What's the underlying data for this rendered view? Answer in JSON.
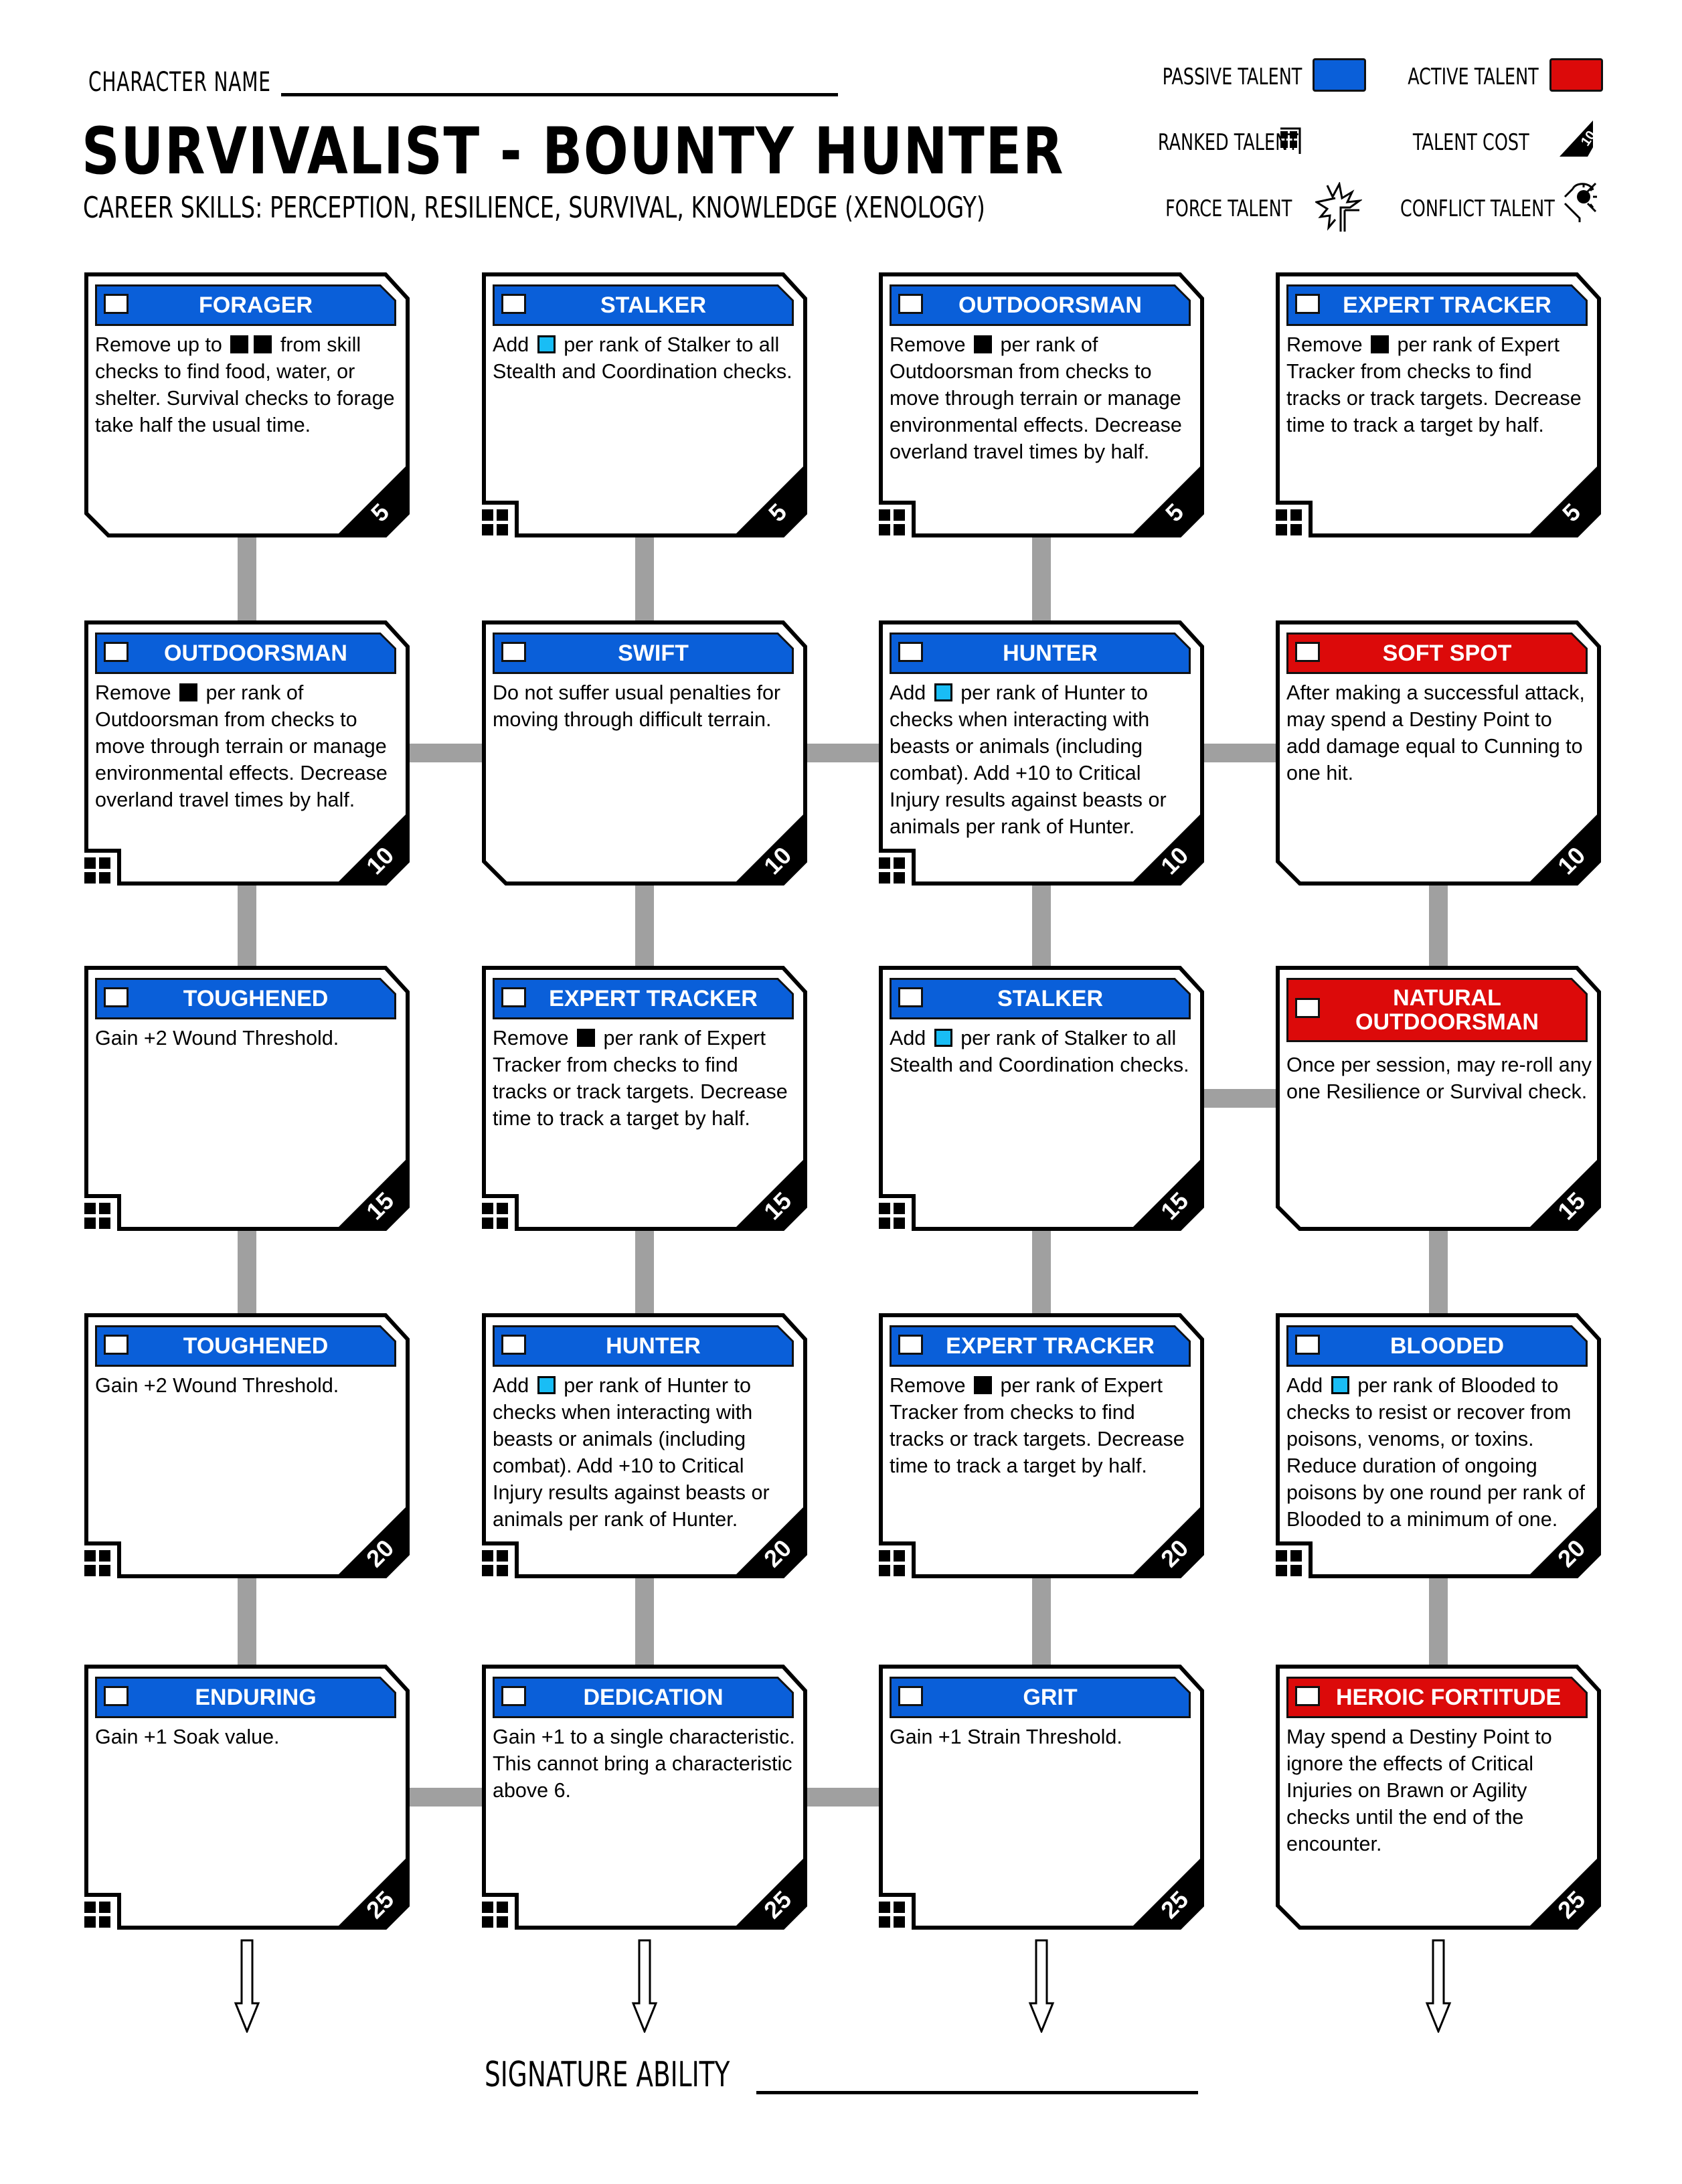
{
  "header": {
    "character_name_label": "CHARACTER NAME",
    "character_name_value": "",
    "title": "SURVIVALIST  -  BOUNTY HUNTER",
    "career_skills": "CAREER SKILLS:  PERCEPTION, RESILIENCE, SURVIVAL, KNOWLEDGE (XENOLOGY)"
  },
  "legend": {
    "passive_label": "PASSIVE TALENT",
    "active_label": "ACTIVE TALENT",
    "ranked_label": "RANKED TALENT",
    "cost_label": "TALENT COST",
    "cost_example": "10",
    "force_label": "FORCE TALENT",
    "conflict_label": "CONFLICT TALENT",
    "passive_color": "#0a5fd9",
    "active_color": "#dc0a0a"
  },
  "colors": {
    "passive": "#0a5fd9",
    "active": "#dc0a0a",
    "connector": "#a0a0a0",
    "boost_die": "#19bdf5",
    "setback_die": "#000000"
  },
  "talents": [
    [
      {
        "name": "FORAGER",
        "type": "passive",
        "ranked": false,
        "cost": "5",
        "desc": [
          "Remove up to ",
          "[setback]",
          "[setback]",
          " from skill checks to find food, water, or shelter. Survival checks to forage take half the usual time."
        ]
      },
      {
        "name": "STALKER",
        "type": "passive",
        "ranked": true,
        "cost": "5",
        "desc": [
          "Add ",
          "[boost]",
          " per rank of Stalker to all Stealth and Coordination checks."
        ]
      },
      {
        "name": "OUTDOORSMAN",
        "type": "passive",
        "ranked": true,
        "cost": "5",
        "desc": [
          "Remove ",
          "[setback]",
          " per rank of Outdoorsman from checks to move through terrain or manage environmental effects. Decrease overland travel times by half."
        ]
      },
      {
        "name": "EXPERT TRACKER",
        "type": "passive",
        "ranked": true,
        "cost": "5",
        "desc": [
          "Remove ",
          "[setback]",
          " per rank of Expert Tracker from checks to find tracks or track targets. Decrease time to track a target by half."
        ]
      }
    ],
    [
      {
        "name": "OUTDOORSMAN",
        "type": "passive",
        "ranked": true,
        "cost": "10",
        "desc": [
          "Remove ",
          "[setback]",
          " per rank of Outdoorsman from checks to move through terrain or manage environmental effects. Decrease overland travel times by half."
        ]
      },
      {
        "name": "SWIFT",
        "type": "passive",
        "ranked": false,
        "cost": "10",
        "desc": [
          "Do not suffer usual penalties for moving through difficult terrain."
        ]
      },
      {
        "name": "HUNTER",
        "type": "passive",
        "ranked": true,
        "cost": "10",
        "desc": [
          "Add ",
          "[boost]",
          " per rank of Hunter to checks when interacting with beasts or animals (including combat). Add +10 to Critical Injury results against beasts or animals per rank of Hunter."
        ]
      },
      {
        "name": "SOFT SPOT",
        "type": "active",
        "ranked": false,
        "cost": "10",
        "desc": [
          "After making a successful attack, may spend a Destiny Point to add damage equal to Cunning to one hit."
        ]
      }
    ],
    [
      {
        "name": "TOUGHENED",
        "type": "passive",
        "ranked": true,
        "cost": "15",
        "desc": [
          "Gain +2 Wound Threshold."
        ]
      },
      {
        "name": "EXPERT TRACKER",
        "type": "passive",
        "ranked": true,
        "cost": "15",
        "desc": [
          "Remove ",
          "[setback]",
          " per rank of Expert Tracker from checks to find tracks or track targets. Decrease time to track a target by half."
        ]
      },
      {
        "name": "STALKER",
        "type": "passive",
        "ranked": true,
        "cost": "15",
        "desc": [
          "Add ",
          "[boost]",
          " per rank of Stalker to all Stealth and Coordination checks."
        ]
      },
      {
        "name": "NATURAL OUTDOORSMAN",
        "type": "active",
        "ranked": false,
        "cost": "15",
        "desc": [
          "Once per session, may re-roll any one Resilience or Survival check."
        ]
      }
    ],
    [
      {
        "name": "TOUGHENED",
        "type": "passive",
        "ranked": true,
        "cost": "20",
        "desc": [
          "Gain +2 Wound Threshold."
        ]
      },
      {
        "name": "HUNTER",
        "type": "passive",
        "ranked": true,
        "cost": "20",
        "desc": [
          "Add ",
          "[boost]",
          " per rank of Hunter to checks when interacting with beasts or animals (including combat). Add +10 to Critical Injury results against beasts or animals per rank of Hunter."
        ]
      },
      {
        "name": "EXPERT TRACKER",
        "type": "passive",
        "ranked": true,
        "cost": "20",
        "desc": [
          "Remove ",
          "[setback]",
          " per rank of Expert Tracker from checks to find tracks or track targets. Decrease time to track a target by half."
        ]
      },
      {
        "name": "BLOODED",
        "type": "passive",
        "ranked": true,
        "cost": "20",
        "desc": [
          "Add ",
          "[boost]",
          " per rank of Blooded to checks to resist or recover from poisons, venoms, or toxins. Reduce duration of ongoing poisons by one round per rank of Blooded to a minimum of one."
        ]
      }
    ],
    [
      {
        "name": "ENDURING",
        "type": "passive",
        "ranked": true,
        "cost": "25",
        "desc": [
          "Gain +1 Soak value."
        ]
      },
      {
        "name": "DEDICATION",
        "type": "passive",
        "ranked": true,
        "cost": "25",
        "desc": [
          "Gain +1 to a single characteristic. This cannot bring a characteristic above 6."
        ]
      },
      {
        "name": "GRIT",
        "type": "passive",
        "ranked": true,
        "cost": "25",
        "desc": [
          "Gain +1 Strain Threshold."
        ]
      },
      {
        "name": "HEROIC FORTITUDE",
        "type": "active",
        "ranked": false,
        "cost": "25",
        "desc": [
          "May spend a Destiny Point to ignore the effects of Critical Injuries on Brawn or Agility checks until the end of the encounter."
        ]
      }
    ]
  ],
  "links": {
    "vertical": [
      [
        true,
        true,
        true,
        false
      ],
      [
        true,
        true,
        true,
        true
      ],
      [
        true,
        true,
        true,
        true
      ],
      [
        true,
        true,
        true,
        true
      ]
    ],
    "horizontal": [
      [
        false,
        false,
        false
      ],
      [
        true,
        true,
        true
      ],
      [
        false,
        false,
        true
      ],
      [
        false,
        false,
        false
      ],
      [
        true,
        true,
        false
      ]
    ]
  },
  "footer": {
    "signature_label": "SIGNATURE ABILITY",
    "signature_value": ""
  }
}
